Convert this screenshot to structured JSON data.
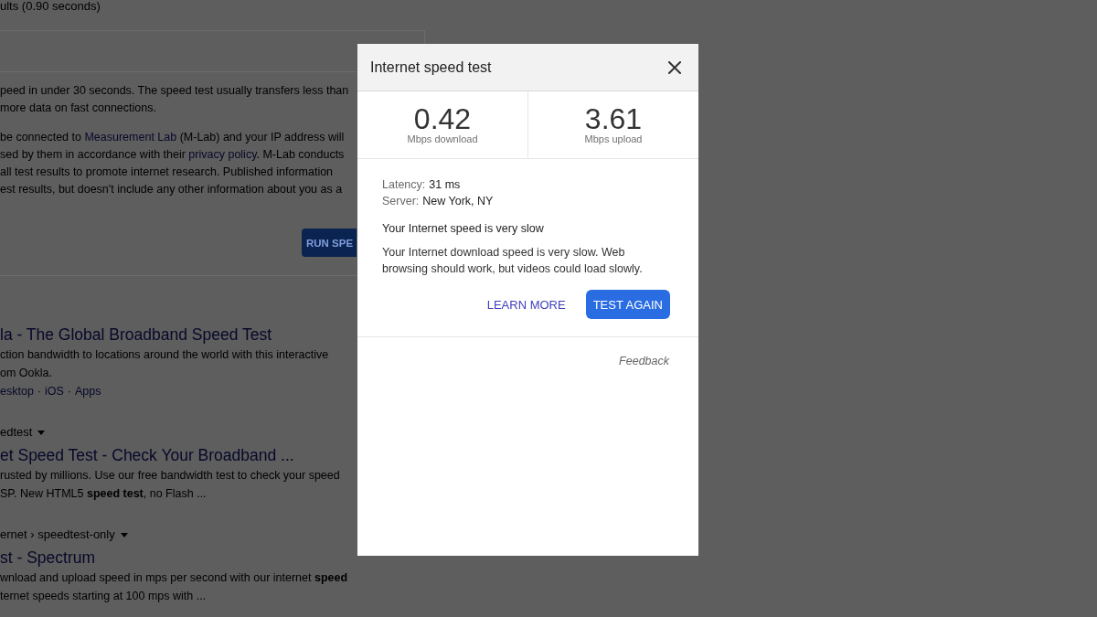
{
  "search_page": {
    "result_stats": "ults (0.90 seconds)",
    "speed_test_card": {
      "paragraphs": [
        {
          "lines": [
            [
              {
                "kind": "text",
                "text": "peed in under 30 seconds. The speed test usually transfers less than"
              }
            ],
            [
              {
                "kind": "text",
                "text": "more data on fast connections."
              }
            ]
          ]
        },
        {
          "lines": [
            [
              {
                "kind": "text",
                "text": "be connected to "
              },
              {
                "kind": "link",
                "text": "Measurement Lab"
              },
              {
                "kind": "text",
                "text": " (M-Lab) and your IP address will"
              }
            ],
            [
              {
                "kind": "text",
                "text": "sed by them in accordance with their "
              },
              {
                "kind": "link",
                "text": "privacy policy"
              },
              {
                "kind": "text",
                "text": ". M-Lab conducts"
              }
            ],
            [
              {
                "kind": "text",
                "text": "all test results to promote internet research. Published information"
              }
            ],
            [
              {
                "kind": "text",
                "text": "est results, but doesn't include any other information about you as a"
              }
            ]
          ]
        }
      ],
      "button": "RUN SPE"
    },
    "results": [
      {
        "title": "la - The Global Broadband Speed Test",
        "snippet": [
          "ction bandwidth to locations around the world with this interactive",
          "om Ookla."
        ],
        "sitelinks": [
          {
            "kind": "link",
            "text": "esktop"
          },
          {
            "kind": "separator",
            "text": "·"
          },
          {
            "kind": "link",
            "text": "iOS"
          },
          {
            "kind": "separator",
            "text": "·"
          },
          {
            "kind": "link",
            "text": "Apps"
          }
        ]
      },
      {
        "breadcrumb": "edtest",
        "title": "et Speed Test - Check Your Broadband ...",
        "snippet": [
          "rusted by millions. Use our free bandwidth test to check your speed",
          "SP. New HTML5 **speed test**, no Flash ..."
        ]
      },
      {
        "breadcrumb": "ernet › speedtest-only",
        "title": "st - Spectrum",
        "snippet": [
          "wnload and upload speed in mps per second with our internet **speed**",
          "ternet speeds starting at 100 mps with ..."
        ]
      }
    ]
  },
  "dialog": {
    "title": "Internet speed test",
    "stats": [
      {
        "value": "0.42",
        "label": "Mbps download"
      },
      {
        "value": "3.61",
        "label": "Mbps upload"
      }
    ],
    "details": [
      {
        "label": "Latency:",
        "value": "31 ms"
      },
      {
        "label": "Server:",
        "value": "New York, NY"
      }
    ],
    "verdict": "Your Internet speed is very slow",
    "explanation": "Your Internet download speed is very slow. Web browsing should work, but videos could load slowly.",
    "actions": [
      {
        "kind": "text",
        "label": "LEARN MORE"
      },
      {
        "kind": "filled",
        "label": "TEST AGAIN"
      }
    ],
    "feedback": "Feedback"
  }
}
